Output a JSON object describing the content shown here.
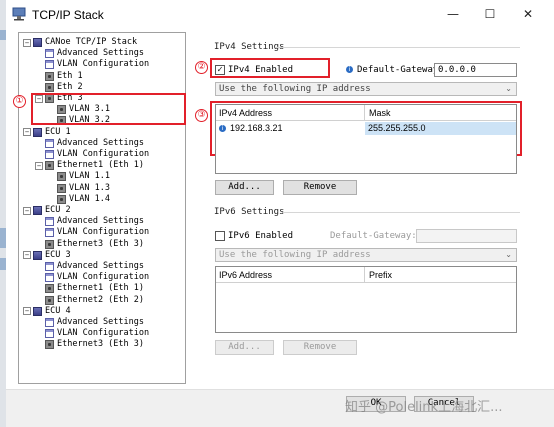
{
  "window": {
    "title": "TCP/IP Stack",
    "minimize_glyph": "—",
    "maximize_glyph": "☐",
    "close_glyph": "✕"
  },
  "tree": {
    "nodes": [
      {
        "label": "CANoe TCP/IP Stack",
        "icon": "computer-icon",
        "expander": "−"
      },
      {
        "label": "Advanced Settings",
        "icon": "settings-icon"
      },
      {
        "label": "VLAN Configuration",
        "icon": "settings-icon"
      },
      {
        "label": "Eth 1",
        "icon": "network-icon"
      },
      {
        "label": "Eth 2",
        "icon": "network-icon"
      },
      {
        "label": "Eth 3",
        "icon": "network-icon",
        "expander": "−"
      },
      {
        "label": "VLAN 3.1",
        "icon": "network-icon"
      },
      {
        "label": "VLAN 3.2",
        "icon": "network-icon"
      },
      {
        "label": "ECU 1",
        "icon": "computer-icon",
        "expander": "−"
      },
      {
        "label": "Advanced Settings",
        "icon": "settings-icon"
      },
      {
        "label": "VLAN Configuration",
        "icon": "settings-icon"
      },
      {
        "label": "Ethernet1 (Eth 1)",
        "icon": "network-icon",
        "expander": "−"
      },
      {
        "label": "VLAN 1.1",
        "icon": "network-icon"
      },
      {
        "label": "VLAN 1.3",
        "icon": "network-icon"
      },
      {
        "label": "VLAN 1.4",
        "icon": "network-icon"
      },
      {
        "label": "ECU 2",
        "icon": "computer-icon",
        "expander": "−"
      },
      {
        "label": "Advanced Settings",
        "icon": "settings-icon"
      },
      {
        "label": "VLAN Configuration",
        "icon": "settings-icon"
      },
      {
        "label": "Ethernet3 (Eth 3)",
        "icon": "network-icon"
      },
      {
        "label": "ECU 3",
        "icon": "computer-icon",
        "expander": "−"
      },
      {
        "label": "Advanced Settings",
        "icon": "settings-icon"
      },
      {
        "label": "VLAN Configuration",
        "icon": "settings-icon"
      },
      {
        "label": "Ethernet1 (Eth 1)",
        "icon": "network-icon"
      },
      {
        "label": "Ethernet2 (Eth 2)",
        "icon": "network-icon"
      },
      {
        "label": "ECU 4",
        "icon": "computer-icon",
        "expander": "−"
      },
      {
        "label": "Advanced Settings",
        "icon": "settings-icon"
      },
      {
        "label": "VLAN Configuration",
        "icon": "settings-icon"
      },
      {
        "label": "Ethernet3 (Eth 3)",
        "icon": "network-icon"
      }
    ]
  },
  "markers": {
    "one": "①",
    "two": "②",
    "three": "③"
  },
  "ipv4": {
    "group_title": "IPv4 Settings",
    "enabled_label": "IPv4 Enabled",
    "enabled_checked": true,
    "check_glyph": "✓",
    "gateway_label": "Default-Gateway",
    "gateway_value": "0.0.0.0",
    "mode_value": "Use the following IP address",
    "columns": [
      "IPv4 Address",
      "Mask"
    ],
    "rows": [
      {
        "address": "192.168.3.21",
        "mask": "255.255.255.0"
      }
    ],
    "add_label": "Add...",
    "remove_label": "Remove"
  },
  "ipv6": {
    "group_title": "IPv6 Settings",
    "enabled_label": "IPv6 Enabled",
    "enabled_checked": false,
    "gateway_label": "Default-Gateway:",
    "gateway_value": "",
    "mode_value": "Use the following IP address",
    "columns": [
      "IPv6 Address",
      "Prefix"
    ],
    "add_label": "Add...",
    "remove_label": "Remove"
  },
  "footer": {
    "ok_label": "OK",
    "cancel_label": "Cancel",
    "watermark": "知乎 @Polelink上海北汇..."
  },
  "colors": {
    "annotation": "#e2202a",
    "selection": "#cde3f6",
    "info": "#2b6cc4"
  }
}
